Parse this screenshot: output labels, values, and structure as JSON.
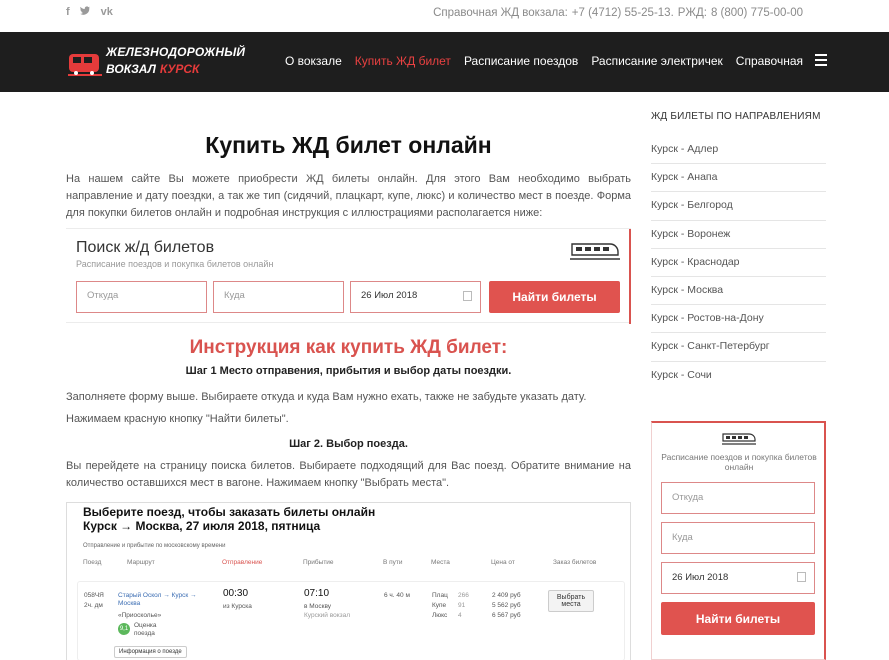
{
  "topbar": {
    "social": [
      "f",
      "t",
      "vk"
    ],
    "contacts_label": "Справочная ЖД вокзала:",
    "phone1": "+7 (4712) 55-25-13.",
    "phone2_label": "РЖД:",
    "phone2": "8 (800) 775-00-00"
  },
  "header": {
    "logo_line1": "ЖЕЛЕЗНОДОРОЖНЫЙ",
    "logo_line2": "ВОКЗАЛ",
    "logo_city": "КУРСК",
    "nav": [
      "О вокзале",
      "Купить ЖД билет",
      "Расписание поездов",
      "Расписание электричек",
      "Справочная"
    ]
  },
  "main": {
    "title": "Купить ЖД билет онлайн",
    "intro": "На нашем сайте Вы можете приобрести ЖД билеты онлайн. Для этого Вам необходимо выбрать направление и дату поездки, а так же тип (сидячий, плацкарт, купе, люкс) и количество мест в поезде. Форма для покупки билетов онлайн и подробная инструкция с иллюстрациями располагается ниже:",
    "search": {
      "title": "Поиск ж/д билетов",
      "subtitle": "Расписание поездов и покупка билетов онлайн",
      "from_placeholder": "Откуда",
      "to_placeholder": "Куда",
      "date": "26 Июл 2018",
      "button": "Найти билеты"
    },
    "instr_title": "Инструкция как купить ЖД билет:",
    "step1_title": "Шаг 1 Место отправения, прибытия и выбор даты поездки.",
    "step1_p1": "Заполняете форму выше. Выбираете откуда и куда Вам нужно ехать, также не забудьте указать дату.",
    "step1_p2": "Нажимаем красную кнопку \"Найти билеты\".",
    "step2_title": "Шаг 2. Выбор поезда.",
    "step2_p1": "Вы перейдете на страницу поиска билетов. Выбираете подходящий для Вас поезд. Обратите внимание на количество оставшихся мест в вагоне. Нажимаем кнопку \"Выбрать места\"."
  },
  "shot": {
    "title": "Выберите поезд, чтобы заказать билеты онлайн",
    "route": "Курск → Москва, 27 июля 2018, пятница",
    "note": "Отправление и прибытие по московскому времени",
    "headers": [
      "Поезд",
      "Маршрут",
      "Отправление",
      "Прибытие",
      "В пути",
      "Места",
      "Цена от",
      "Заказ билетов"
    ],
    "train_no": "058ЧЯ",
    "train_type": "2ч. дм",
    "route_text": "Старый Оскол → Курск → Москва",
    "route_name": "«Приосколье»",
    "rating": "9,1",
    "rating_label": "Оценка поезда",
    "dep_time": "00:30",
    "dep_place": "из Курска",
    "arr_time": "07:10",
    "arr_place": "в Москву",
    "arr_station": "Курский вокзал",
    "duration": "6 ч. 40 м",
    "classes": [
      "Плац",
      "Купе",
      "Люкс"
    ],
    "counts": [
      "266",
      "91",
      "4"
    ],
    "prices": [
      "2 409 руб",
      "5 562 руб",
      "6 567 руб"
    ],
    "select_button": "Выбрать места",
    "info_button": "Информация о поезде"
  },
  "sidebar": {
    "heading": "ЖД БИЛЕТЫ ПО НАПРАВЛЕНИЯМ",
    "items": [
      "Курск - Адлер",
      "Курск - Анапа",
      "Курск - Белгород",
      "Курск - Воронеж",
      "Курск - Краснодар",
      "Курск - Москва",
      "Курск - Ростов-на-Дону",
      "Курск - Санкт-Петербург",
      "Курск - Сочи"
    ],
    "box_subtitle": "Расписание поездов и покупка билетов онлайн",
    "from_placeholder": "Откуда",
    "to_placeholder": "Куда",
    "date": "26 Июл 2018",
    "button": "Найти билеты"
  },
  "colors": {
    "accent": "#e0534f",
    "header_bg": "#1e1e1e"
  }
}
